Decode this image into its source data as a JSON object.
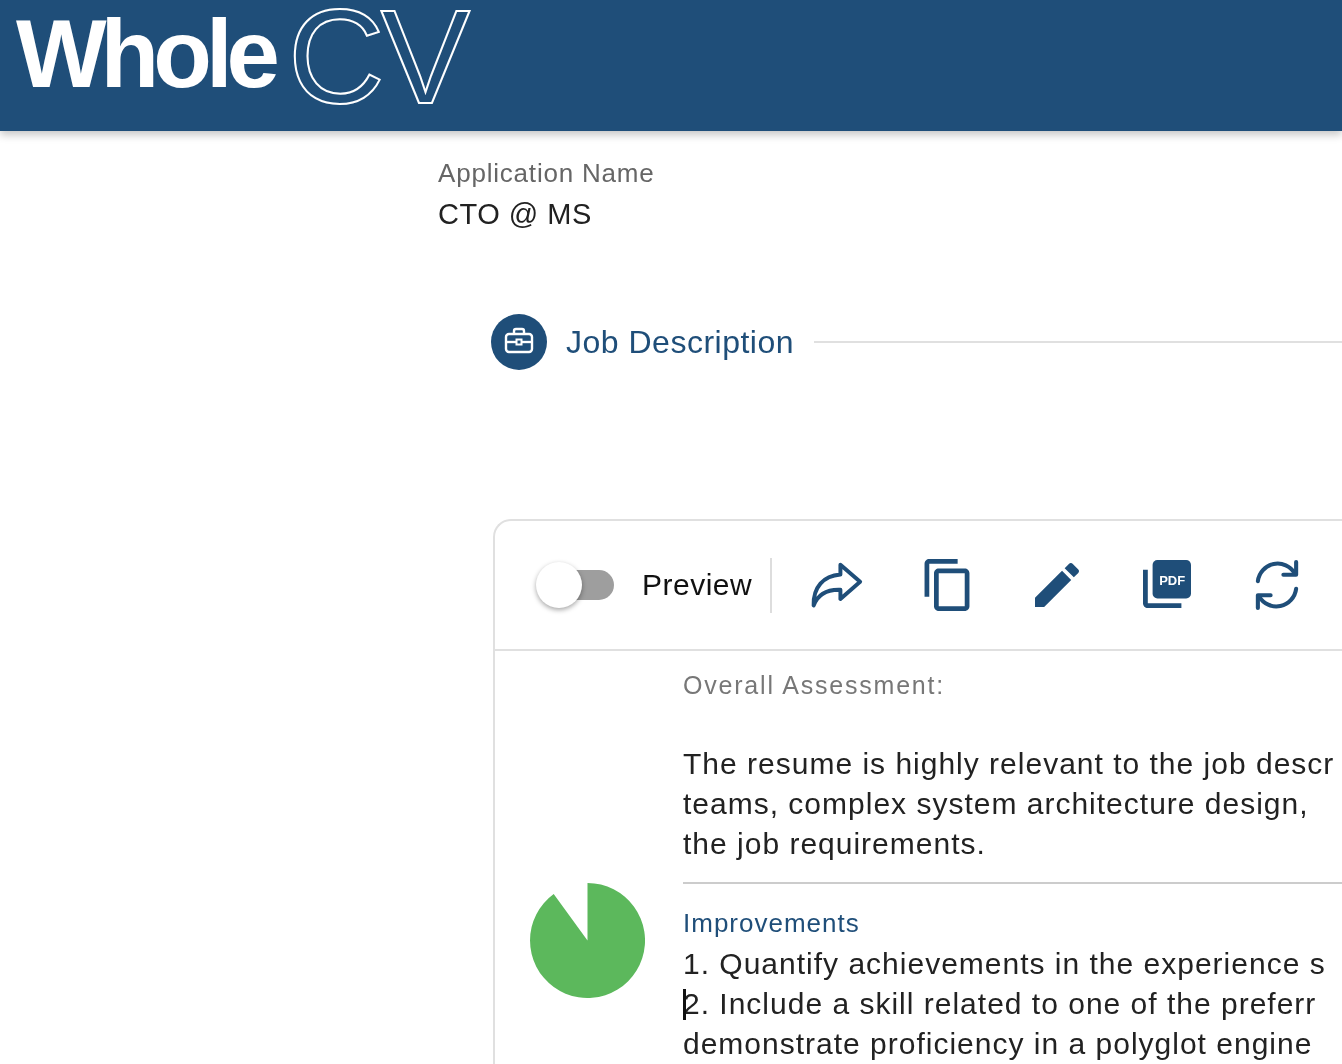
{
  "header": {
    "logo": {
      "text": "Whole",
      "outlined_text": "CV"
    }
  },
  "application": {
    "label": "Application Name",
    "value": "CTO @ MS"
  },
  "stepper": {
    "steps": [
      {
        "label": "Job Description",
        "selected": true
      }
    ]
  },
  "card": {
    "toolbar": {
      "preview": {
        "label": "Preview",
        "on": false
      },
      "actions": [
        {
          "kind": "share"
        },
        {
          "kind": "copy"
        },
        {
          "kind": "edit"
        },
        {
          "kind": "pdf",
          "label": "PDF"
        },
        {
          "kind": "refresh"
        }
      ]
    },
    "assessment": {
      "heading": "Overall Assessment:",
      "summary_lines": [
        "The resume is highly relevant to the job descr",
        "teams, complex system architecture design,",
        "the job requirements."
      ],
      "improvements": {
        "heading": "Improvements",
        "lines": [
          {
            "text": "1. Quantify achievements in the experience s",
            "cursor": false
          },
          {
            "text": "2. Include a skill related to one of the preferr",
            "cursor": true
          },
          {
            "text": "demonstrate proficiency in a polyglot engine",
            "cursor": false
          }
        ]
      }
    }
  }
}
